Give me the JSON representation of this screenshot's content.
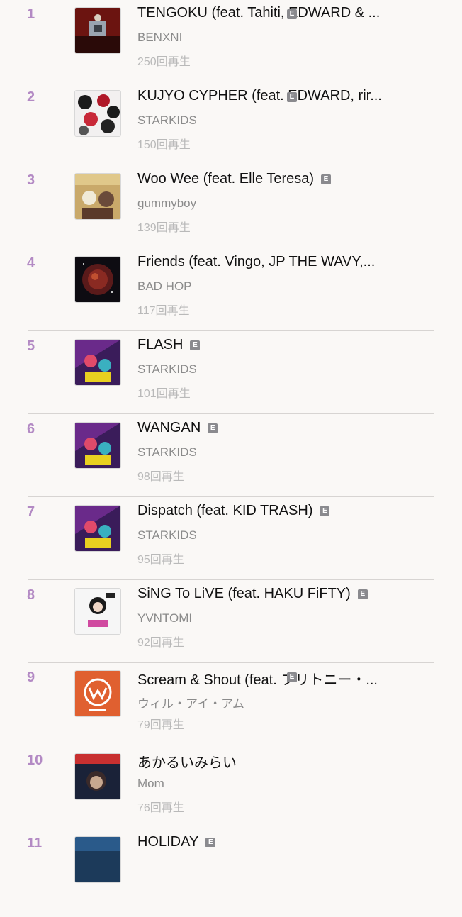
{
  "tracks": [
    {
      "rank": "1",
      "title": "TENGOKU (feat. Tahiti, EDWARD & ...",
      "artist": "BENXNI",
      "plays": "250回再生",
      "explicit": "E",
      "art": "tengoku-cover"
    },
    {
      "rank": "2",
      "title": "KUJYO CYPHER (feat. EDWARD, rir...",
      "artist": "STARKIDS",
      "plays": "150回再生",
      "explicit": "E",
      "art": "kujyo-cover"
    },
    {
      "rank": "3",
      "title": "Woo Wee (feat. Elle Teresa)",
      "artist": "gummyboy",
      "plays": "139回再生",
      "explicit": "E",
      "art": "woowee-cover"
    },
    {
      "rank": "4",
      "title": "Friends (feat. Vingo, JP THE WAVY,...",
      "artist": "BAD HOP",
      "plays": "117回再生",
      "explicit": "",
      "art": "friends-cover"
    },
    {
      "rank": "5",
      "title": "FLASH",
      "artist": "STARKIDS",
      "plays": "101回再生",
      "explicit": "E",
      "art": "starkids-cover"
    },
    {
      "rank": "6",
      "title": "WANGAN",
      "artist": "STARKIDS",
      "plays": "98回再生",
      "explicit": "E",
      "art": "starkids-cover"
    },
    {
      "rank": "7",
      "title": "Dispatch (feat. KID TRASH)",
      "artist": "STARKIDS",
      "plays": "95回再生",
      "explicit": "E",
      "art": "starkids-cover"
    },
    {
      "rank": "8",
      "title": "SiNG To LiVE (feat. HAKU FiFTY)",
      "artist": "YVNTOMI",
      "plays": "92回再生",
      "explicit": "E",
      "art": "singtolive-cover"
    },
    {
      "rank": "9",
      "title": "Scream & Shout (feat. ブリトニー・...",
      "artist": "ウィル・アイ・アム",
      "plays": "79回再生",
      "explicit": "E",
      "art": "william-cover"
    },
    {
      "rank": "10",
      "title": "あかるいみらい",
      "artist": "Mom",
      "plays": "76回再生",
      "explicit": "",
      "art": "akarui-cover"
    },
    {
      "rank": "11",
      "title": "HOLIDAY",
      "artist": "",
      "plays": "",
      "explicit": "E",
      "art": "holiday-cover"
    }
  ],
  "colors": {
    "rank": "#b38ac4",
    "background": "#faf8f6",
    "explicit_badge": "#8a8a8e"
  }
}
